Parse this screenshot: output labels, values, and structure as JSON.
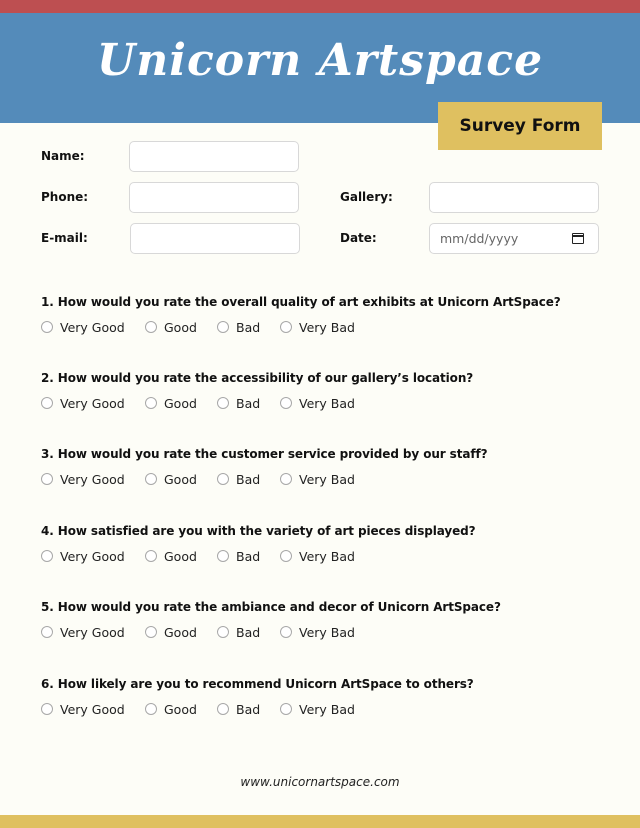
{
  "header": {
    "title": "Unicorn Artspace",
    "badge": "Survey Form"
  },
  "colors": {
    "top_stripe": "#bd4f51",
    "header_blue": "#548bba",
    "accent_gold": "#dfc060",
    "page_background": "#fdfdf7"
  },
  "form": {
    "name_label": "Name:",
    "name_value": "",
    "phone_label": "Phone:",
    "phone_value": "",
    "email_label": "E-mail:",
    "email_value": "",
    "gallery_label": "Gallery:",
    "gallery_value": "",
    "date_label": "Date:",
    "date_placeholder": "mm/dd/yyyy",
    "date_icon": "calendar-icon"
  },
  "questions": [
    {
      "text": "1. How would you rate the overall quality of art exhibits at Unicorn ArtSpace?",
      "options": [
        "Very Good",
        "Good",
        "Bad",
        "Very Bad"
      ]
    },
    {
      "text": "2. How would you rate the accessibility of our gallery’s location?",
      "options": [
        "Very Good",
        "Good",
        "Bad",
        "Very Bad"
      ]
    },
    {
      "text": "3. How would you rate the customer service provided by our staff?",
      "options": [
        "Very Good",
        "Good",
        "Bad",
        "Very Bad"
      ]
    },
    {
      "text": "4. How satisfied are you with the variety of art pieces displayed?",
      "options": [
        "Very Good",
        "Good",
        "Bad",
        "Very Bad"
      ]
    },
    {
      "text": "5. How would you rate the ambiance and decor of Unicorn ArtSpace?",
      "options": [
        "Very Good",
        "Good",
        "Bad",
        "Very Bad"
      ]
    },
    {
      "text": "6. How likely are you to recommend Unicorn ArtSpace to others?",
      "options": [
        "Very Good",
        "Good",
        "Bad",
        "Very Bad"
      ]
    }
  ],
  "footer": {
    "url": "www.unicornartspace.com"
  }
}
